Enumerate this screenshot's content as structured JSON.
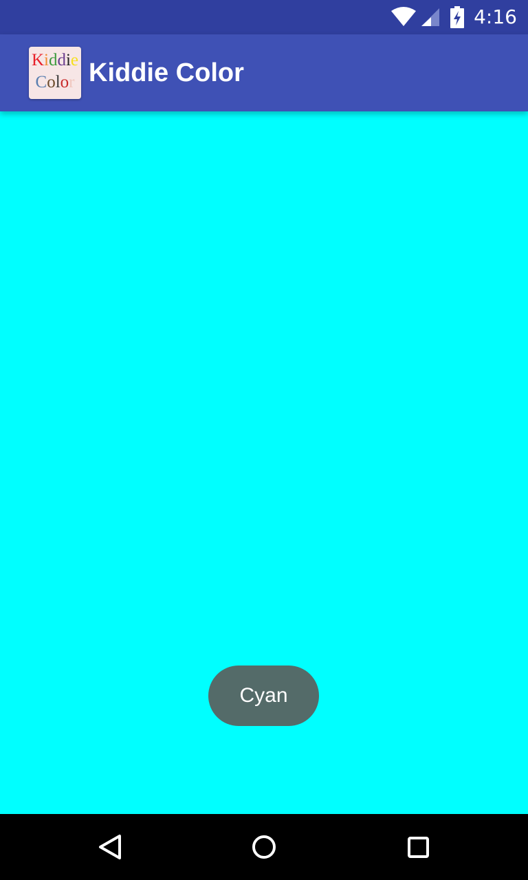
{
  "status_bar": {
    "time": "4:16",
    "icons": [
      "wifi-icon",
      "cell-signal-icon",
      "battery-charging-icon"
    ],
    "background": "#303f9f"
  },
  "app_bar": {
    "title": "Kiddie Color",
    "background": "#3f51b5",
    "logo": {
      "line1": [
        {
          "ch": "K",
          "color": "#e8202a"
        },
        {
          "ch": "i",
          "color": "#f08a30"
        },
        {
          "ch": "d",
          "color": "#3c9a3c"
        },
        {
          "ch": "d",
          "color": "#6a3c8c"
        },
        {
          "ch": "i",
          "color": "#222222"
        },
        {
          "ch": "e",
          "color": "#f5e020"
        }
      ],
      "line2": [
        {
          "ch": "C",
          "color": "#5a7fb0"
        },
        {
          "ch": "o",
          "color": "#6b4a2a"
        },
        {
          "ch": "l",
          "color": "#3a3a3a"
        },
        {
          "ch": "o",
          "color": "#c82a2a"
        },
        {
          "ch": "r",
          "color": "#f0c8c0"
        }
      ]
    }
  },
  "content": {
    "background_color": "#00ffff"
  },
  "toast": {
    "text": "Cyan",
    "background": "#546b69"
  },
  "nav_bar": {
    "buttons": [
      "back-icon",
      "home-icon",
      "recents-icon"
    ]
  }
}
